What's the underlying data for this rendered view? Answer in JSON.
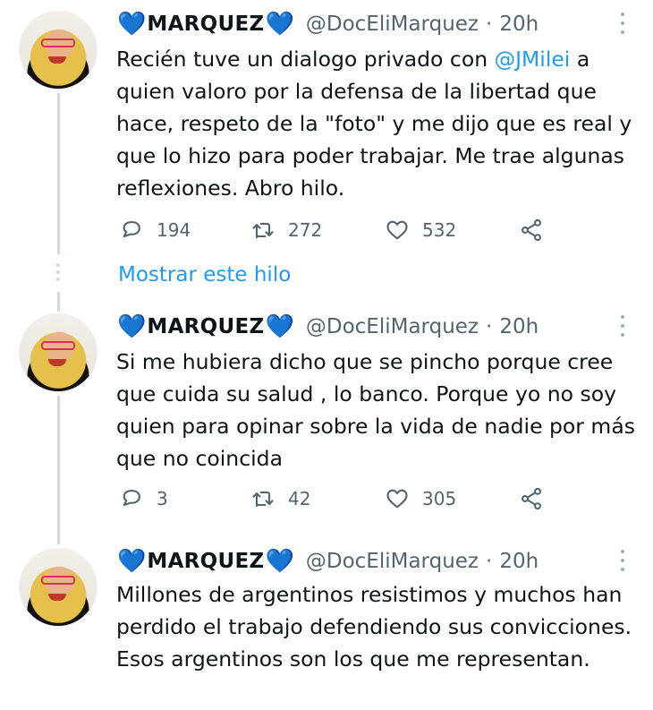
{
  "user": {
    "display_name": "MARQUEZ",
    "handle": "@DocEliMarquez",
    "separator": "·",
    "heart_glyph": "💙"
  },
  "tweets": [
    {
      "time": "20h",
      "text_before": "Recién tuve un dialogo privado con ",
      "mention": "@JMilei",
      "text_after": " a quien valoro por la defensa de la libertad que hace, respeto de la \"foto\" y me dijo que es real y que lo hizo para poder trabajar. Me trae algunas reflexiones. Abro hilo.",
      "replies": "194",
      "retweets": "272",
      "likes": "532"
    },
    {
      "time": "20h",
      "text": "Si me hubiera dicho que se pincho porque cree que cuida su salud , lo banco. Porque yo no soy quien para opinar sobre la vida de nadie por más que no coincida",
      "replies": "3",
      "retweets": "42",
      "likes": "305"
    },
    {
      "time": "20h",
      "text": "Millones de argentinos resistimos y muchos han perdido el trabajo defendiendo sus convicciones. Esos argentinos son los que me representan."
    }
  ],
  "show_thread_label": "Mostrar este hilo",
  "colors": {
    "accent": "#1d9bf0",
    "heart": "#4a9fe8",
    "muted": "#536471"
  }
}
